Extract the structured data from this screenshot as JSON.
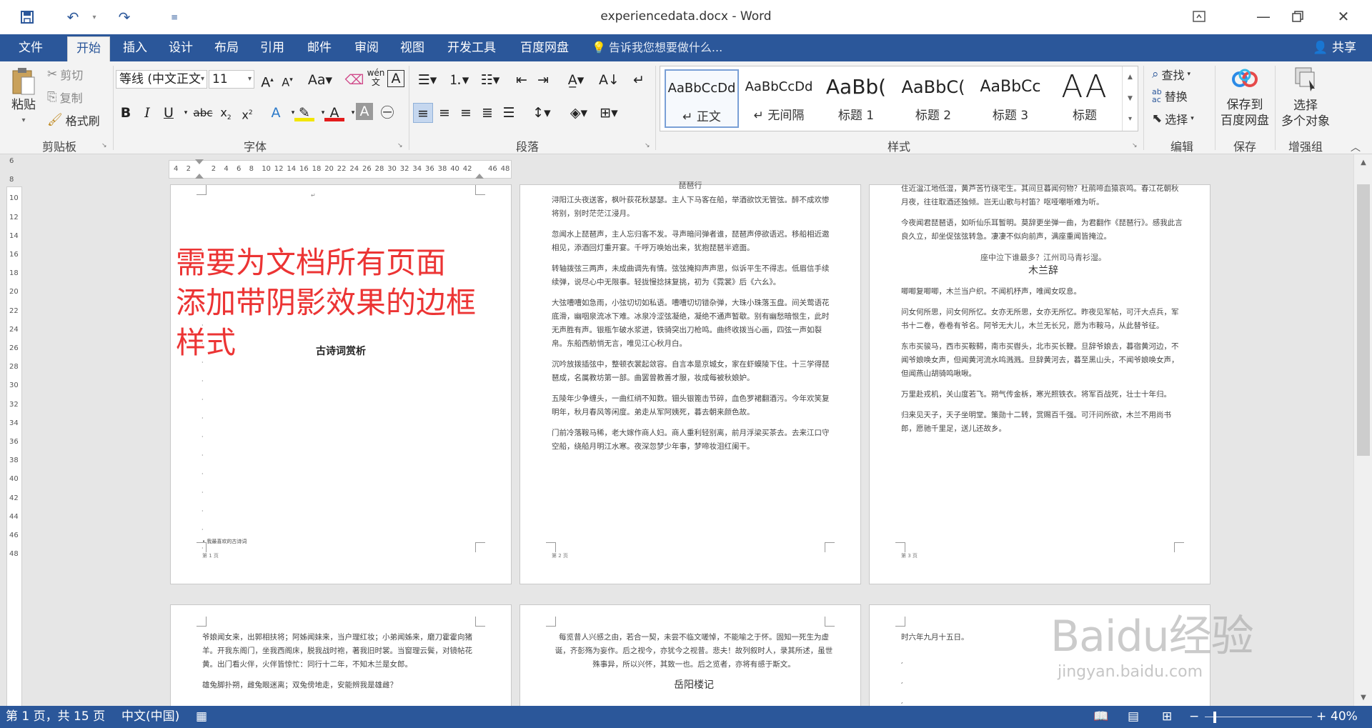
{
  "window": {
    "title": "experiencedata.docx - Word",
    "qat": {
      "save_icon": "save-icon",
      "undo_icon": "undo-icon",
      "redo_icon": "redo-icon",
      "customize_icon": "customize-icon"
    }
  },
  "tabs": [
    {
      "label": "文件"
    },
    {
      "label": "开始"
    },
    {
      "label": "插入"
    },
    {
      "label": "设计"
    },
    {
      "label": "布局"
    },
    {
      "label": "引用"
    },
    {
      "label": "邮件"
    },
    {
      "label": "审阅"
    },
    {
      "label": "视图"
    },
    {
      "label": "开发工具"
    },
    {
      "label": "百度网盘"
    }
  ],
  "tellme": "告诉我您想要做什么...",
  "share": "共享",
  "ribbon": {
    "clipboard": {
      "paste": "粘贴",
      "cut": "剪切",
      "copy": "复制",
      "format_painter": "格式刷",
      "label": "剪贴板"
    },
    "font": {
      "font_name": "等线 (中文正文",
      "font_size": "11",
      "label": "字体"
    },
    "paragraph": {
      "label": "段落"
    },
    "styles": {
      "label": "样式",
      "items": [
        {
          "preview": "AaBbCcDd",
          "name": "↵ 正文"
        },
        {
          "preview": "AaBbCcDd",
          "name": "↵ 无间隔"
        },
        {
          "preview": "AaBb(",
          "name": "标题 1"
        },
        {
          "preview": "AaBbC(",
          "name": "标题 2"
        },
        {
          "preview": "AaBbCc",
          "name": "标题 3"
        },
        {
          "preview": "AA",
          "name": "标题"
        }
      ]
    },
    "editing": {
      "find": "查找",
      "replace": "替换",
      "select": "选择",
      "label": "编辑"
    },
    "save": {
      "button": "保存到\n百度网盘",
      "line1": "保存到",
      "line2": "百度网盘",
      "label": "保存"
    },
    "enhance": {
      "line1": "选择",
      "line2": "多个对象",
      "label": "增强组"
    }
  },
  "overlay_text": {
    "line1": "需要为文档所有页面",
    "line2": "添加带阴影效果的边框",
    "line3": "样式"
  },
  "pages": {
    "p1": {
      "title": "古诗词赏析",
      "footnote": "• 我最喜欢的古诗词",
      "num": "第 1 页"
    },
    "p2": {
      "top": "琵琶行",
      "paras": [
        "浔阳江头夜送客，枫叶荻花秋瑟瑟。主人下马客在船，举酒欲饮无管弦。醉不成欢惨将别，别时茫茫江浸月。",
        "忽闻水上琵琶声，主人忘归客不发。寻声暗问弹者谁，琵琶声停欲语迟。移船相近邀相见，添酒回灯重开宴。千呼万唤始出来，犹抱琵琶半遮面。",
        "转轴拨弦三两声，未成曲调先有情。弦弦掩抑声声思，似诉平生不得志。低眉信手续续弹，说尽心中无限事。轻拢慢捻抹复挑，初为《霓裳》后《六幺》。",
        "大弦嘈嘈如急雨，小弦切切如私语。嘈嘈切切错杂弹，大珠小珠落玉盘。间关莺语花底滑，幽咽泉流冰下难。冰泉冷涩弦凝绝，凝绝不通声暂歇。别有幽愁暗恨生，此时无声胜有声。银瓶乍破水浆迸，铁骑突出刀枪鸣。曲终收拨当心画，四弦一声如裂帛。东船西舫悄无言，唯见江心秋月白。",
        "沉吟放拨插弦中，整顿衣裳起敛容。自言本是京城女，家在虾蟆陵下住。十三学得琵琶成，名属教坊第一部。曲罢曾教善才服，妆成每被秋娘妒。",
        "五陵年少争缠头，一曲红绡不知数。钿头银篦击节碎，血色罗裙翻酒污。今年欢笑复明年，秋月春风等闲度。弟走从军阿姨死，暮去朝来颜色故。",
        "门前冷落鞍马稀，老大嫁作商人妇。商人重利轻别离，前月浮梁买茶去。去来江口守空船，绕船月明江水寒。夜深忽梦少年事，梦啼妆泪红阑干。"
      ],
      "num": "第 2 页"
    },
    "p3": {
      "paras": [
        "住近湓江地低湿，黄芦苦竹绕宅生。其间旦暮闻何物？杜鹃啼血猿哀鸣。春江花朝秋月夜，往往取酒还独倾。岂无山歌与村笛？呕哑嘲哳难为听。",
        "今夜闻君琵琶语，如听仙乐耳暂明。莫辞更坐弹一曲，为君翻作《琵琶行》。感我此言良久立，却坐促弦弦转急。凄凄不似向前声，满座重闻皆掩泣。"
      ],
      "end_line": "座中泣下谁最多？江州司马青衫湿。",
      "title2": "木兰辞",
      "paras2": [
        "唧唧复唧唧，木兰当户织。不闻机杼声，唯闻女叹息。",
        "问女何所思，问女何所忆。女亦无所思，女亦无所忆。昨夜见军帖，可汗大点兵，军书十二卷，卷卷有爷名。阿爷无大儿，木兰无长兄，愿为市鞍马，从此替爷征。",
        "东市买骏马，西市买鞍鞯，南市买辔头，北市买长鞭。旦辞爷娘去，暮宿黄河边，不闻爷娘唤女声，但闻黄河流水鸣溅溅。旦辞黄河去，暮至黑山头，不闻爷娘唤女声，但闻燕山胡骑鸣啾啾。",
        "万里赴戎机，关山度若飞。朔气传金柝，寒光照铁衣。将军百战死，壮士十年归。",
        "归来见天子，天子坐明堂。策勋十二转，赏赐百千强。可汗问所欲，木兰不用尚书郎，愿驰千里足，送儿还故乡。"
      ],
      "num": "第 3 页"
    },
    "p4": {
      "paras": [
        "爷娘闻女来，出郭相扶将；阿姊闻妹来，当户理红妆；小弟闻姊来，磨刀霍霍向猪羊。开我东阁门，坐我西阁床，脱我战时袍，著我旧时裳。当窗理云鬓，对镜帖花黄。出门看火伴，火伴皆惊忙：同行十二年，不知木兰是女郎。",
        "雄兔脚扑朔，雌兔眼迷离；双兔傍地走，安能辨我是雄雌？"
      ]
    },
    "p5": {
      "paras": [
        "每览昔人兴感之由，若合一契，未尝不临文嗟悼，不能喻之于怀。固知一死生为虚诞，齐彭殇为妄作。后之视今，亦犹今之视昔。悲夫！故列叙时人，录其所述，虽世殊事异，所以兴怀，其致一也。后之览者，亦将有感于斯文。"
      ],
      "title": "岳阳楼记"
    },
    "p6": {
      "paras": [
        "时六年九月十五日。"
      ]
    }
  },
  "status": {
    "page": "第 1 页，共 15 页",
    "lang": "中文(中国)",
    "zoom": "40%"
  },
  "watermark": {
    "logo": "Baidu经验",
    "url": "jingyan.baidu.com"
  }
}
